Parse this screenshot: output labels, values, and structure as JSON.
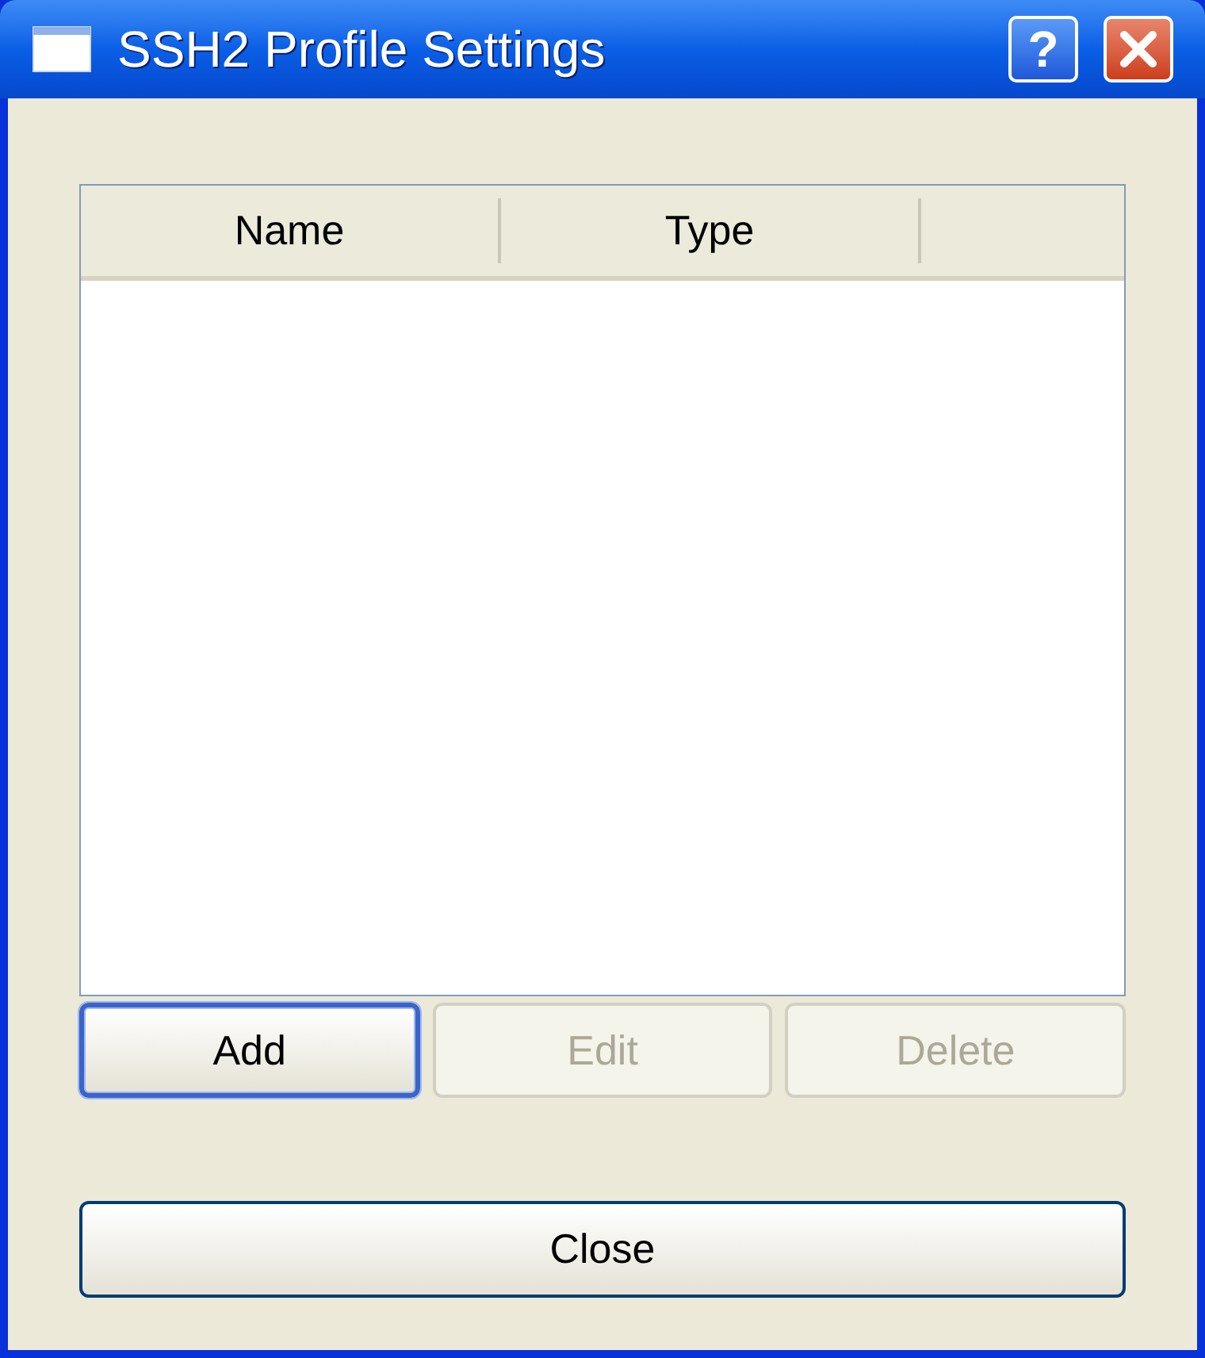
{
  "window": {
    "title": "SSH2 Profile Settings",
    "controls": [
      "?"
    ]
  },
  "table": {
    "columns": [
      "Name",
      "Type"
    ]
  },
  "buttons": [
    {
      "label": "Add",
      "disabled": false,
      "focused": true
    },
    {
      "label": "Edit",
      "disabled": true,
      "focused": false
    },
    {
      "label": "Delete",
      "disabled": true,
      "focused": false
    }
  ],
  "close_button": {
    "label": "Close",
    "disabled": false
  }
}
